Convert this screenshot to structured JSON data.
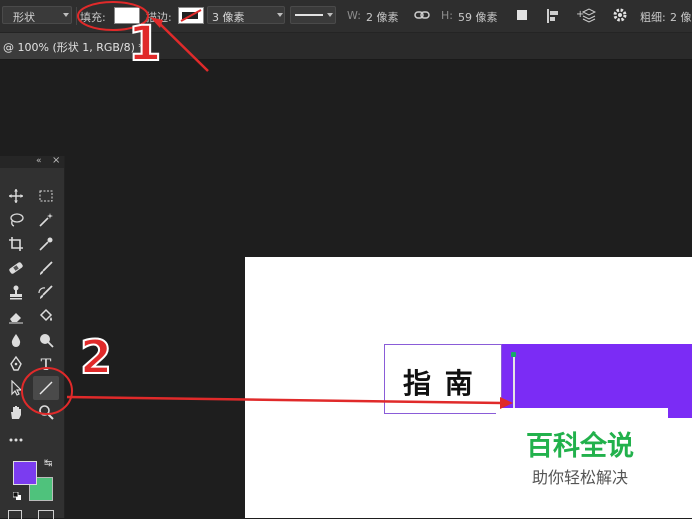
{
  "options_bar": {
    "tool_mode": "形状",
    "fill_label": "填充:",
    "stroke_label": "描边:",
    "stroke_width": "3 像素",
    "w_label": "W:",
    "w_value": "2 像素",
    "h_label": "H:",
    "h_value": "59 像素",
    "weight_label": "粗细:",
    "weight_value": "2 像"
  },
  "document_tab": {
    "title": "@ 100% (形状 1, RGB/8) *"
  },
  "toolbar": {
    "foreground_color": "#7b3cf0",
    "background_color": "#4fc27c",
    "tools": [
      "move-tool",
      "marquee-tool",
      "lasso-tool",
      "magic-wand-tool",
      "crop-tool",
      "eyedropper-tool",
      "healing-brush-tool",
      "brush-tool",
      "clone-stamp-tool",
      "history-brush-tool",
      "eraser-tool",
      "paint-bucket-tool",
      "blur-tool",
      "dodge-tool",
      "pen-tool",
      "text-tool",
      "path-selection-tool",
      "line-tool",
      "hand-tool",
      "zoom-tool",
      "more-tools"
    ],
    "text_tool_glyph": "T"
  },
  "canvas": {
    "text_box": "指 南",
    "shape_color": "#7b2cf5"
  },
  "annotations": {
    "step_1": "1",
    "step_2": "2",
    "color": "#e02a2a"
  },
  "watermark": {
    "title": "百科全说",
    "subtitle": "助你轻松解决",
    "title_color": "#22b14c"
  }
}
